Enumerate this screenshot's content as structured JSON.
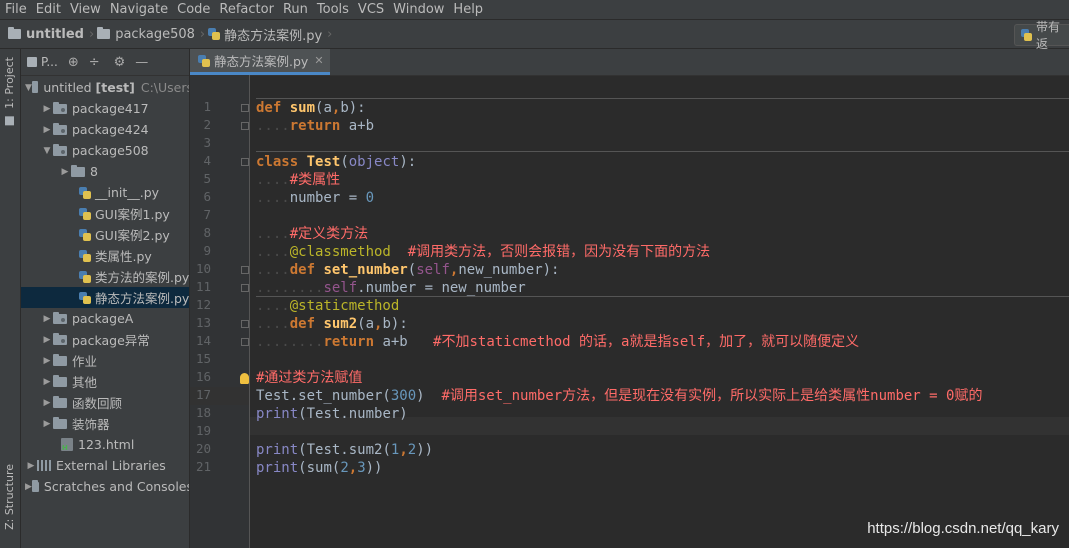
{
  "menu": [
    "File",
    "Edit",
    "View",
    "Navigate",
    "Code",
    "Refactor",
    "Run",
    "Tools",
    "VCS",
    "Window",
    "Help"
  ],
  "breadcrumb": {
    "project": "untitled",
    "package": "package508",
    "file": "静态方法案例.py"
  },
  "run_config_label": "带有返",
  "left_strip": {
    "project_tab": "1: Project",
    "structure_tab": "Z: Structure"
  },
  "project_panel": {
    "title": "P...",
    "root_name": "untitled",
    "root_tag": "[test]",
    "root_path": "C:\\Users"
  },
  "tree": [
    {
      "label": "package417"
    },
    {
      "label": "package424"
    },
    {
      "label": "package508"
    },
    {
      "label": "8"
    },
    {
      "label": "__init__.py"
    },
    {
      "label": "GUI案例1.py"
    },
    {
      "label": "GUI案例2.py"
    },
    {
      "label": "类属性.py"
    },
    {
      "label": "类方法的案例.py"
    },
    {
      "label": "静态方法案例.py"
    },
    {
      "label": "packageA"
    },
    {
      "label": "package异常"
    },
    {
      "label": "作业"
    },
    {
      "label": "其他"
    },
    {
      "label": "函数回顾"
    },
    {
      "label": "装饰器"
    },
    {
      "label": "123.html"
    },
    {
      "label": "External Libraries"
    },
    {
      "label": "Scratches and Consoles"
    }
  ],
  "editor": {
    "tab_label": "静态方法案例.py",
    "line_numbers": [
      "1",
      "2",
      "3",
      "4",
      "5",
      "6",
      "7",
      "8",
      "9",
      "10",
      "11",
      "12",
      "13",
      "14",
      "15",
      "16",
      "17",
      "18",
      "19",
      "20",
      "21"
    ],
    "comments": {
      "class_attr": "#类属性",
      "define_cls": "#定义类方法",
      "cls_note": "#调用类方法，否则会报错，因为没有下面的方法",
      "static_note": "#不加staticmethod 的话，a就是指self，加了，就可以随便定义",
      "via_cls": "#通过类方法赋值",
      "set_note": "#调用set_number方法，但是现在没有实例，所以实际上是给类属性number = 0赋的"
    }
  },
  "watermark": "https://blog.csdn.net/qq_kary"
}
